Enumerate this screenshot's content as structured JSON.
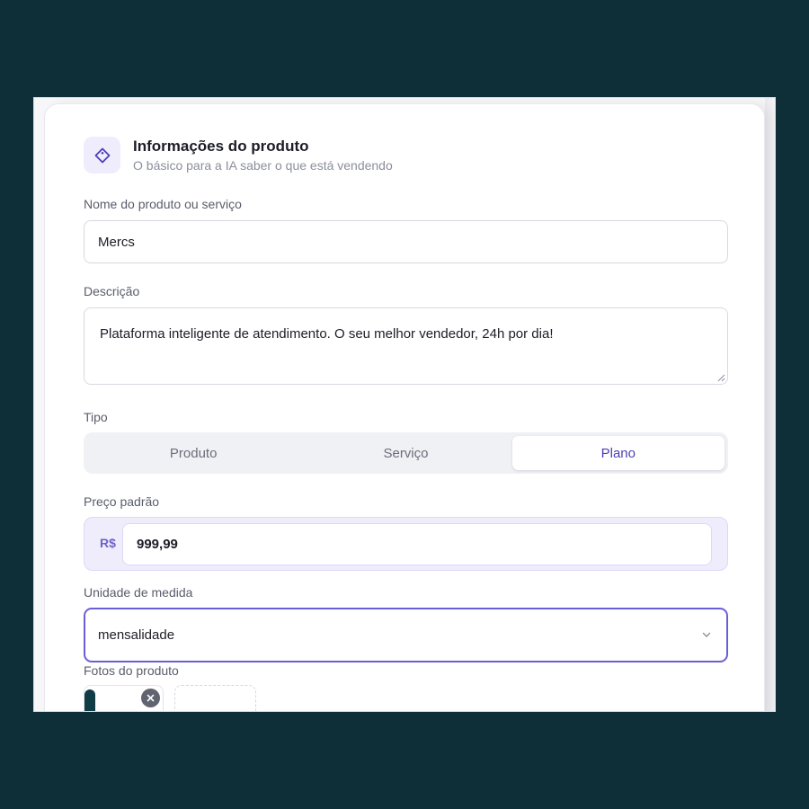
{
  "card": {
    "title": "Informações do produto",
    "subtitle": "O básico para a IA saber o que está vendendo",
    "icon": "tag-icon"
  },
  "fields": {
    "name": {
      "label": "Nome do produto ou serviço",
      "value": "Mercs"
    },
    "description": {
      "label": "Descrição",
      "value": "Plataforma inteligente de atendimento. O seu melhor vendedor, 24h por dia!"
    },
    "type": {
      "label": "Tipo",
      "options": [
        "Produto",
        "Serviço",
        "Plano"
      ],
      "selected": "Plano"
    },
    "price": {
      "label": "Preço padrão",
      "currency": "R$",
      "value": "999,99"
    },
    "unit": {
      "label": "Unidade de medida",
      "value": "mensalidade",
      "icon": "chevron-down-icon"
    },
    "photos": {
      "label": "Fotos do produto",
      "remove_icon": "close-icon"
    }
  },
  "colors": {
    "page_background": "#0f2f38",
    "accent": "#4c3fb4",
    "accent_border": "#6a5ed8",
    "accent_soft": "#efedfc"
  }
}
